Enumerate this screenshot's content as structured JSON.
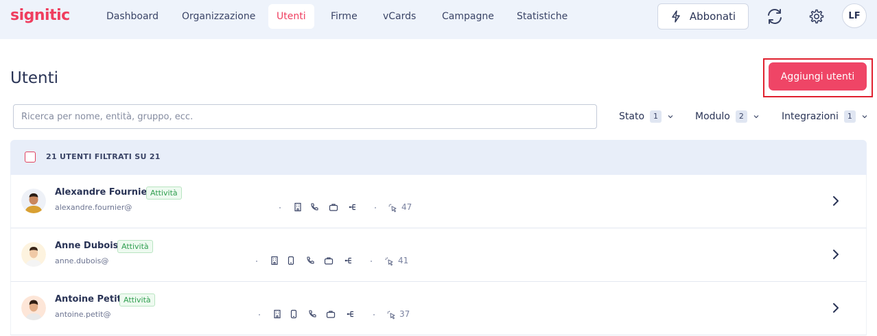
{
  "header": {
    "logo": "signitic",
    "nav": [
      {
        "label": "Dashboard"
      },
      {
        "label": "Organizzazione"
      },
      {
        "label": "Utenti"
      },
      {
        "label": "Firme"
      },
      {
        "label": "vCards"
      },
      {
        "label": "Campagne"
      },
      {
        "label": "Statistiche"
      }
    ],
    "subscribe_label": "Abbonati",
    "sync_icon": "sync-icon",
    "settings_icon": "gear-icon",
    "user_initials": "LF"
  },
  "page": {
    "title": "Utenti",
    "add_button": "Aggiungi utenti",
    "search_placeholder": "Ricerca per nome, entità, gruppo, ecc."
  },
  "filters": [
    {
      "label": "Stato",
      "count": "1"
    },
    {
      "label": "Modulo",
      "count": "2"
    },
    {
      "label": "Integrazioni",
      "count": "1"
    }
  ],
  "table": {
    "count_text": "21 UTENTI FILTRATI SU 21",
    "rows": [
      {
        "name": "Alexandre Fournier",
        "status": "Attività",
        "email": "alexandre.fournier@",
        "clicks": "47",
        "icons": [
          "building-icon",
          "phone-icon",
          "briefcase-icon",
          "hierarchy-icon"
        ]
      },
      {
        "name": "Anne Dubois",
        "status": "Attività",
        "email": "anne.dubois@",
        "clicks": "41",
        "icons": [
          "building-icon",
          "mobile-icon",
          "phone-icon",
          "briefcase-icon",
          "hierarchy-icon"
        ]
      },
      {
        "name": "Antoine Petit",
        "status": "Attività",
        "email": "antoine.petit@",
        "clicks": "37",
        "icons": [
          "building-icon",
          "mobile-icon",
          "phone-icon",
          "briefcase-icon",
          "hierarchy-icon"
        ]
      }
    ]
  },
  "colors": {
    "brand": "#ef3e5f",
    "header_bg": "#eef3fb",
    "status_green": "#2f9e4f"
  }
}
